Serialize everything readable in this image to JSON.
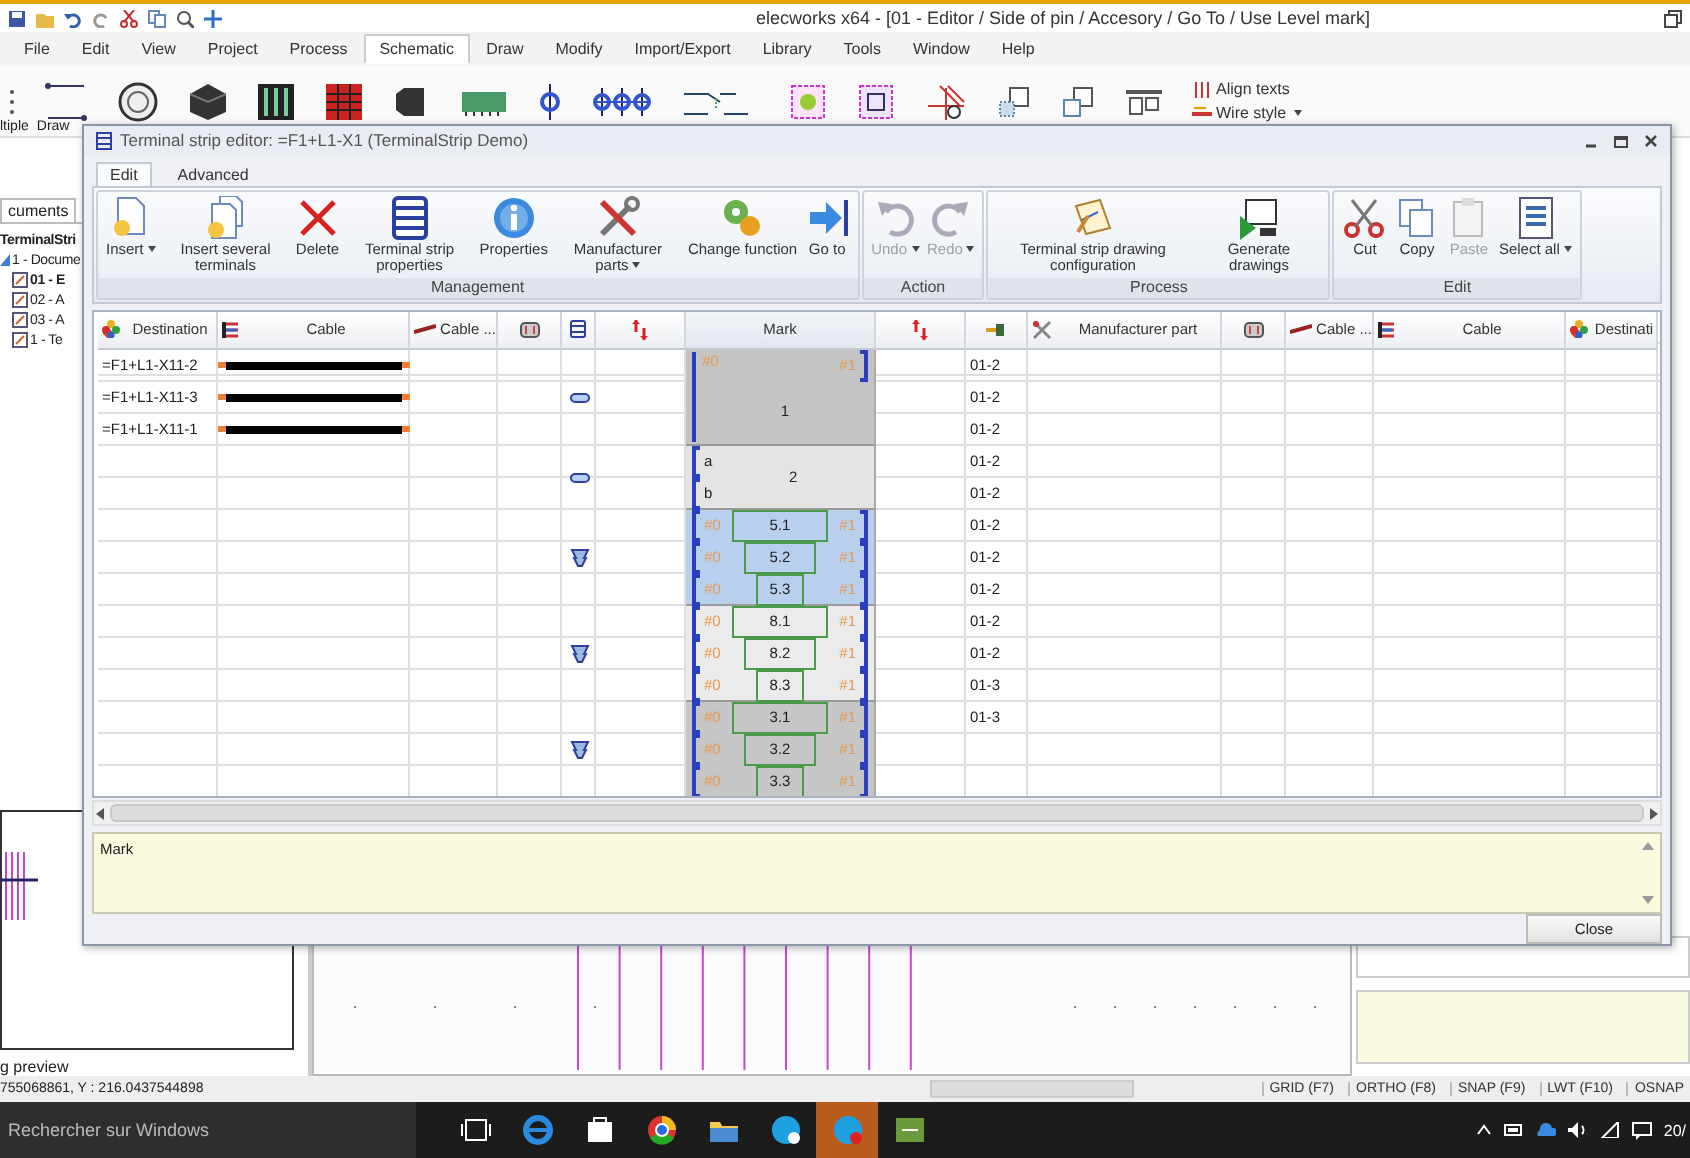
{
  "app": {
    "title": "elecworks x64 - [01 - Editor /  Side of pin / Accesory / Go To /  Use Level mark]",
    "menu": [
      {
        "label": "File",
        "selected": false
      },
      {
        "label": "Edit",
        "selected": false
      },
      {
        "label": "View",
        "selected": false
      },
      {
        "label": "Project",
        "selected": false
      },
      {
        "label": "Process",
        "selected": false
      },
      {
        "label": "Schematic",
        "selected": true
      },
      {
        "label": "Draw",
        "selected": false
      },
      {
        "label": "Modify",
        "selected": false
      },
      {
        "label": "Import/Export",
        "selected": false
      },
      {
        "label": "Library",
        "selected": false
      },
      {
        "label": "Tools",
        "selected": false
      },
      {
        "label": "Window",
        "selected": false
      },
      {
        "label": "Help",
        "selected": false
      }
    ],
    "ribbon_texts": [
      "ltiple",
      "Draw"
    ],
    "ribbon_commands": [
      {
        "label": "Align texts",
        "dropdown": false
      },
      {
        "label": "Wire style",
        "dropdown": true
      }
    ],
    "sidebar": {
      "tab": "cuments",
      "tree": [
        {
          "label": "TerminalStri",
          "selected": true,
          "children": [
            {
              "label": "1 - Docume",
              "selected": false,
              "children": [
                {
                  "label": "01 - E",
                  "selected": true
                },
                {
                  "label": "02 - A",
                  "selected": false
                },
                {
                  "label": "03 - A",
                  "selected": false
                },
                {
                  "label": "1 - Te",
                  "selected": false
                }
              ]
            }
          ]
        }
      ],
      "preview_label": "g preview"
    },
    "status_bar": {
      "coordinates": "755068861, Y : 216.0437544898",
      "toggles": [
        "GRID (F7)",
        "ORTHO (F8)",
        "SNAP (F9)",
        "LWT (F10)",
        "OSNAP"
      ]
    },
    "taskbar": {
      "search": {
        "placeholder": "Rechercher sur Windows"
      },
      "clock": "20/"
    }
  },
  "dialog": {
    "title": "Terminal strip editor: =F1+L1-X1 (TerminalStrip Demo)",
    "tabs": [
      {
        "label": "Edit",
        "selected": true
      },
      {
        "label": "Advanced",
        "selected": false
      }
    ],
    "ribbon_groups": [
      {
        "label": "Management",
        "buttons": [
          {
            "label": "Insert",
            "dropdown": true,
            "disabled": false
          },
          {
            "label": "Insert several terminals",
            "dropdown": false,
            "disabled": false
          },
          {
            "label": "Delete",
            "dropdown": false,
            "disabled": false
          },
          {
            "label": "Terminal strip properties",
            "dropdown": false,
            "disabled": false
          },
          {
            "label": "Properties",
            "dropdown": false,
            "disabled": false
          },
          {
            "label": "Manufacturer parts",
            "dropdown": true,
            "disabled": false
          },
          {
            "label": "Change function",
            "dropdown": false,
            "disabled": false
          },
          {
            "label": "Go to",
            "dropdown": false,
            "disabled": false
          }
        ]
      },
      {
        "label": "Action",
        "buttons": [
          {
            "label": "Undo",
            "dropdown": true,
            "disabled": true
          },
          {
            "label": "Redo",
            "dropdown": true,
            "disabled": true
          }
        ]
      },
      {
        "label": "Process",
        "buttons": [
          {
            "label": "Terminal strip drawing configuration",
            "dropdown": false,
            "disabled": false
          },
          {
            "label": "Generate drawings",
            "dropdown": false,
            "disabled": false
          }
        ]
      },
      {
        "label": "Edit",
        "buttons": [
          {
            "label": "Cut",
            "dropdown": false,
            "disabled": false
          },
          {
            "label": "Copy",
            "dropdown": false,
            "disabled": false
          },
          {
            "label": "Paste",
            "dropdown": false,
            "disabled": true
          },
          {
            "label": "Select all",
            "dropdown": true,
            "disabled": false
          }
        ]
      }
    ],
    "table": {
      "columns": [
        "Destination",
        "Cable",
        "Cable ...",
        "Mark",
        "Manufacturer part",
        "Cable ...",
        "Cable",
        "Destinati"
      ],
      "groups": [
        {
          "kind": "merged",
          "label": "1",
          "left": "#0",
          "right": "#1",
          "color": "#c4c4c4",
          "rows": [
            {
              "destination": "=F1+L1-X11-2",
              "wired": true,
              "page": "01-2"
            },
            {
              "destination": "=F1+L1-X11-3",
              "wired": true,
              "page": "01-2"
            },
            {
              "destination": "=F1+L1-X11-1",
              "wired": true,
              "page": "01-2"
            }
          ]
        },
        {
          "kind": "split",
          "label": "2",
          "color": "#e4e4e4",
          "rows": [
            {
              "part": "a",
              "wired": false,
              "page": "01-2"
            },
            {
              "part": "b",
              "wired": false,
              "page": "01-2"
            }
          ]
        },
        {
          "kind": "levels",
          "color": "#b8d0ee",
          "rows": [
            {
              "mark": "5.1",
              "left": "#0",
              "right": "#1",
              "wired": false,
              "page": "01-2"
            },
            {
              "mark": "5.2",
              "left": "#0",
              "right": "#1",
              "wired": false,
              "page": "01-2"
            },
            {
              "mark": "5.3",
              "left": "#0",
              "right": "#1",
              "wired": false,
              "page": "01-2"
            }
          ]
        },
        {
          "kind": "levels",
          "color": "#ebebeb",
          "rows": [
            {
              "mark": "8.1",
              "left": "#0",
              "right": "#1",
              "wired": false,
              "page": "01-2"
            },
            {
              "mark": "8.2",
              "left": "#0",
              "right": "#1",
              "wired": false,
              "page": "01-2"
            },
            {
              "mark": "8.3",
              "left": "#0",
              "right": "#1",
              "wired": false,
              "page": "01-3"
            }
          ]
        },
        {
          "kind": "levels",
          "color": "#c6c6c6",
          "rows": [
            {
              "mark": "3.1",
              "left": "#0",
              "right": "#1",
              "wired": false,
              "page": "01-3"
            },
            {
              "mark": "3.2",
              "left": "#0",
              "right": "#1",
              "wired": false
            },
            {
              "mark": "3.3",
              "left": "#0",
              "right": "#1",
              "wired": false
            }
          ]
        }
      ]
    },
    "description": "Mark",
    "close_button": "Close"
  }
}
